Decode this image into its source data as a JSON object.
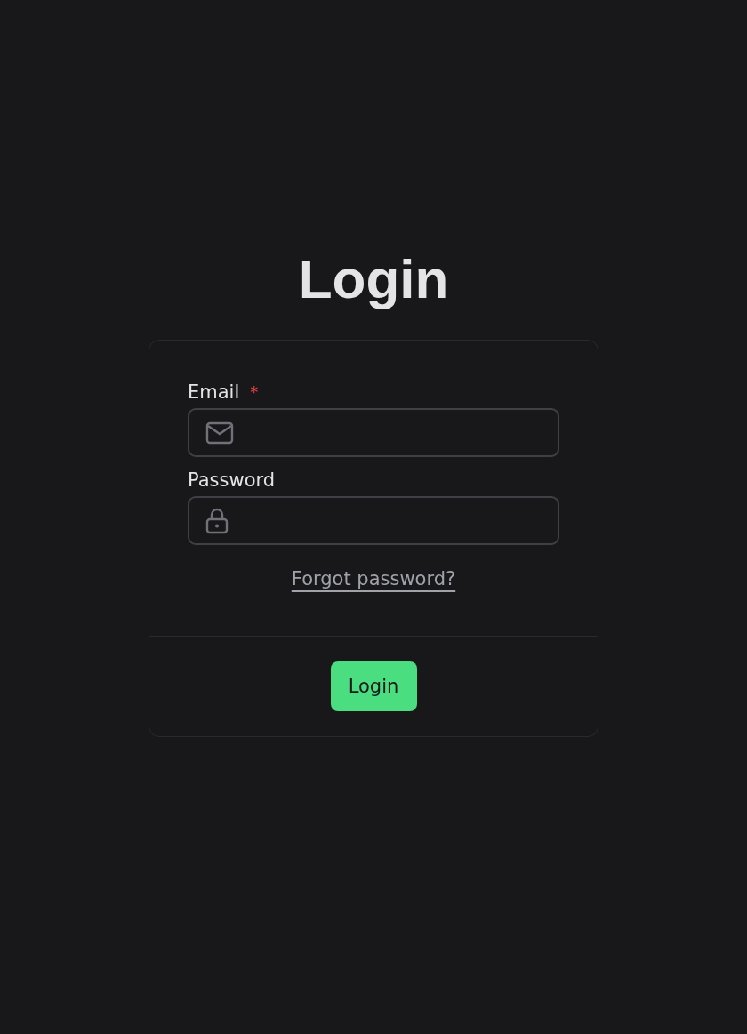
{
  "title": "Login",
  "fields": [
    {
      "kind": "email",
      "label": "Email",
      "required_mark": "*"
    },
    {
      "kind": "password",
      "label": "Password"
    }
  ],
  "forgot_link": "Forgot password?",
  "submit_button": "Login"
}
